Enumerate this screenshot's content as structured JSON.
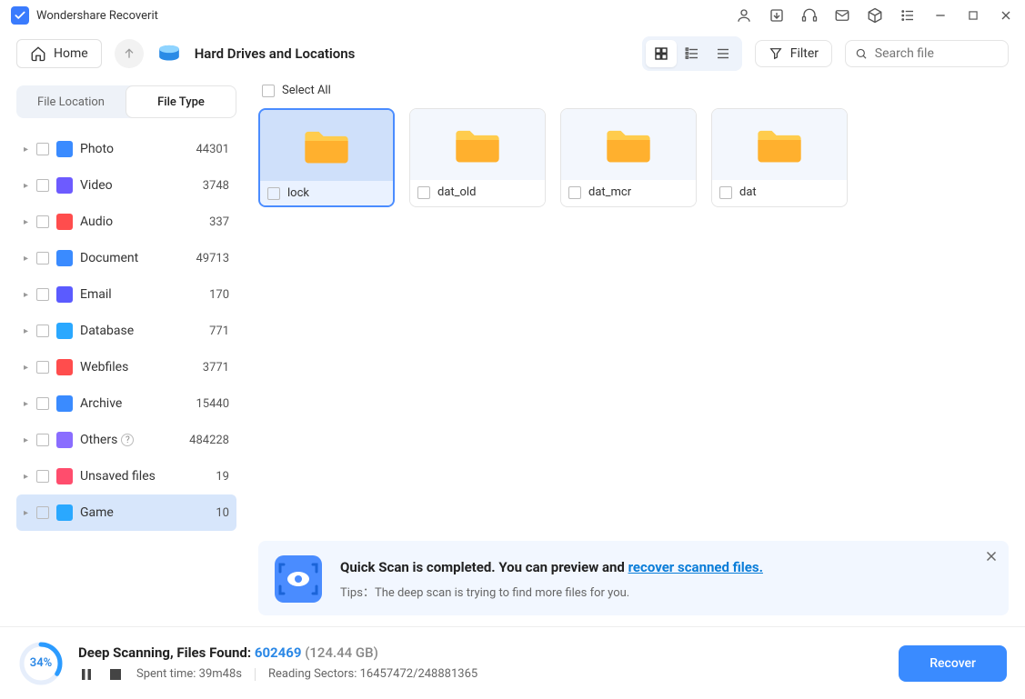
{
  "app": {
    "title": "Wondershare Recoverit"
  },
  "header": {
    "home": "Home",
    "location": "Hard Drives and Locations",
    "filter": "Filter",
    "searchPlaceholder": "Search file"
  },
  "sidebar": {
    "tabs": {
      "location": "File Location",
      "type": "File Type"
    },
    "items": [
      {
        "label": "Photo",
        "count": "44301",
        "color": "#3a8bff"
      },
      {
        "label": "Video",
        "count": "3748",
        "color": "#6d5bff"
      },
      {
        "label": "Audio",
        "count": "337",
        "color": "#ff4d4d"
      },
      {
        "label": "Document",
        "count": "49713",
        "color": "#3a8bff"
      },
      {
        "label": "Email",
        "count": "170",
        "color": "#5b5bff"
      },
      {
        "label": "Database",
        "count": "771",
        "color": "#2aa8ff"
      },
      {
        "label": "Webfiles",
        "count": "3771",
        "color": "#ff4d4d"
      },
      {
        "label": "Archive",
        "count": "15440",
        "color": "#3a8bff"
      },
      {
        "label": "Others",
        "count": "484228",
        "color": "#8a6dff"
      },
      {
        "label": "Unsaved files",
        "count": "19",
        "color": "#ff4d6d"
      },
      {
        "label": "Game",
        "count": "10",
        "color": "#2aa8ff"
      }
    ],
    "selectedIndex": 10,
    "helpIndex": 8
  },
  "content": {
    "selectAll": "Select All",
    "tiles": [
      {
        "label": "lock",
        "selected": true
      },
      {
        "label": "dat_old",
        "selected": false
      },
      {
        "label": "dat_mcr",
        "selected": false
      },
      {
        "label": "dat",
        "selected": false
      }
    ]
  },
  "notice": {
    "titlePrefix": "Quick Scan is completed. You can preview and ",
    "link": "recover scanned files.",
    "tipLabel": "Tips：",
    "tipText": "The deep scan is trying to find more files for you."
  },
  "footer": {
    "percent": "34%",
    "percentValue": 34,
    "scanPrefix": "Deep Scanning, Files Found: ",
    "scanCount": "602469",
    "scanSize": "(124.44 GB)",
    "spentLabel": "Spent time: ",
    "spentValue": "39m48s",
    "sectorsLabel": "Reading Sectors: ",
    "sectorsValue": "16457472/248881365",
    "recover": "Recover"
  }
}
